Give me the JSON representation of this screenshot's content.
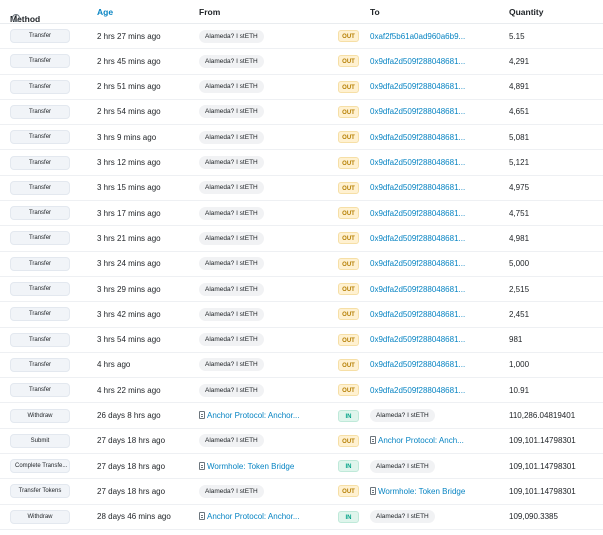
{
  "header": {
    "method": "Method",
    "age": "Age",
    "from": "From",
    "to": "To",
    "quantity": "Quantity",
    "info_glyph": "i"
  },
  "rows": [
    {
      "method": "Transfer",
      "age": "2 hrs 27 mins ago",
      "from": "Alameda? I stETH",
      "from_type": "pill",
      "dir": "OUT",
      "to": "0xaf2f5b61a0ad960a6b9...",
      "to_type": "link",
      "qty": "5.15"
    },
    {
      "method": "Transfer",
      "age": "2 hrs 45 mins ago",
      "from": "Alameda? I stETH",
      "from_type": "pill",
      "dir": "OUT",
      "to": "0x9dfa2d509f288048681...",
      "to_type": "link",
      "qty": "4,291"
    },
    {
      "method": "Transfer",
      "age": "2 hrs 51 mins ago",
      "from": "Alameda? I stETH",
      "from_type": "pill",
      "dir": "OUT",
      "to": "0x9dfa2d509f288048681...",
      "to_type": "link",
      "qty": "4,891"
    },
    {
      "method": "Transfer",
      "age": "2 hrs 54 mins ago",
      "from": "Alameda? I stETH",
      "from_type": "pill",
      "dir": "OUT",
      "to": "0x9dfa2d509f288048681...",
      "to_type": "link",
      "qty": "4,651"
    },
    {
      "method": "Transfer",
      "age": "3 hrs 9 mins ago",
      "from": "Alameda? I stETH",
      "from_type": "pill",
      "dir": "OUT",
      "to": "0x9dfa2d509f288048681...",
      "to_type": "link",
      "qty": "5,081"
    },
    {
      "method": "Transfer",
      "age": "3 hrs 12 mins ago",
      "from": "Alameda? I stETH",
      "from_type": "pill",
      "dir": "OUT",
      "to": "0x9dfa2d509f288048681...",
      "to_type": "link",
      "qty": "5,121"
    },
    {
      "method": "Transfer",
      "age": "3 hrs 15 mins ago",
      "from": "Alameda? I stETH",
      "from_type": "pill",
      "dir": "OUT",
      "to": "0x9dfa2d509f288048681...",
      "to_type": "link",
      "qty": "4,975"
    },
    {
      "method": "Transfer",
      "age": "3 hrs 17 mins ago",
      "from": "Alameda? I stETH",
      "from_type": "pill",
      "dir": "OUT",
      "to": "0x9dfa2d509f288048681...",
      "to_type": "link",
      "qty": "4,751"
    },
    {
      "method": "Transfer",
      "age": "3 hrs 21 mins ago",
      "from": "Alameda? I stETH",
      "from_type": "pill",
      "dir": "OUT",
      "to": "0x9dfa2d509f288048681...",
      "to_type": "link",
      "qty": "4,981"
    },
    {
      "method": "Transfer",
      "age": "3 hrs 24 mins ago",
      "from": "Alameda? I stETH",
      "from_type": "pill",
      "dir": "OUT",
      "to": "0x9dfa2d509f288048681...",
      "to_type": "link",
      "qty": "5,000"
    },
    {
      "method": "Transfer",
      "age": "3 hrs 29 mins ago",
      "from": "Alameda? I stETH",
      "from_type": "pill",
      "dir": "OUT",
      "to": "0x9dfa2d509f288048681...",
      "to_type": "link",
      "qty": "2,515"
    },
    {
      "method": "Transfer",
      "age": "3 hrs 42 mins ago",
      "from": "Alameda? I stETH",
      "from_type": "pill",
      "dir": "OUT",
      "to": "0x9dfa2d509f288048681...",
      "to_type": "link",
      "qty": "2,451"
    },
    {
      "method": "Transfer",
      "age": "3 hrs 54 mins ago",
      "from": "Alameda? I stETH",
      "from_type": "pill",
      "dir": "OUT",
      "to": "0x9dfa2d509f288048681...",
      "to_type": "link",
      "qty": "981"
    },
    {
      "method": "Transfer",
      "age": "4 hrs ago",
      "from": "Alameda? I stETH",
      "from_type": "pill",
      "dir": "OUT",
      "to": "0x9dfa2d509f288048681...",
      "to_type": "link",
      "qty": "1,000"
    },
    {
      "method": "Transfer",
      "age": "4 hrs 22 mins ago",
      "from": "Alameda? I stETH",
      "from_type": "pill",
      "dir": "OUT",
      "to": "0x9dfa2d509f288048681...",
      "to_type": "link",
      "qty": "10.91"
    },
    {
      "method": "Withdraw",
      "age": "26 days 8 hrs ago",
      "from": "Anchor Protocol: Anchor...",
      "from_type": "contract",
      "dir": "IN",
      "to": "Alameda? I stETH",
      "to_type": "pill",
      "qty": "110,286.04819401"
    },
    {
      "method": "Submit",
      "age": "27 days 18 hrs ago",
      "from": "Alameda? I stETH",
      "from_type": "pill",
      "dir": "OUT",
      "to": "Anchor Protocol: Anch...",
      "to_type": "contract",
      "qty": "109,101.14798301"
    },
    {
      "method": "Complete Transfe...",
      "age": "27 days 18 hrs ago",
      "from": "Wormhole: Token Bridge",
      "from_type": "contract",
      "dir": "IN",
      "to": "Alameda? I stETH",
      "to_type": "pill",
      "qty": "109,101.14798301"
    },
    {
      "method": "Transfer Tokens",
      "age": "27 days 18 hrs ago",
      "from": "Alameda? I stETH",
      "from_type": "pill",
      "dir": "OUT",
      "to": "Wormhole: Token Bridge",
      "to_type": "contract",
      "qty": "109,101.14798301"
    },
    {
      "method": "Withdraw",
      "age": "28 days 46 mins ago",
      "from": "Anchor Protocol: Anchor...",
      "from_type": "contract",
      "dir": "IN",
      "to": "Alameda? I stETH",
      "to_type": "pill",
      "qty": "109,090.3385"
    }
  ]
}
